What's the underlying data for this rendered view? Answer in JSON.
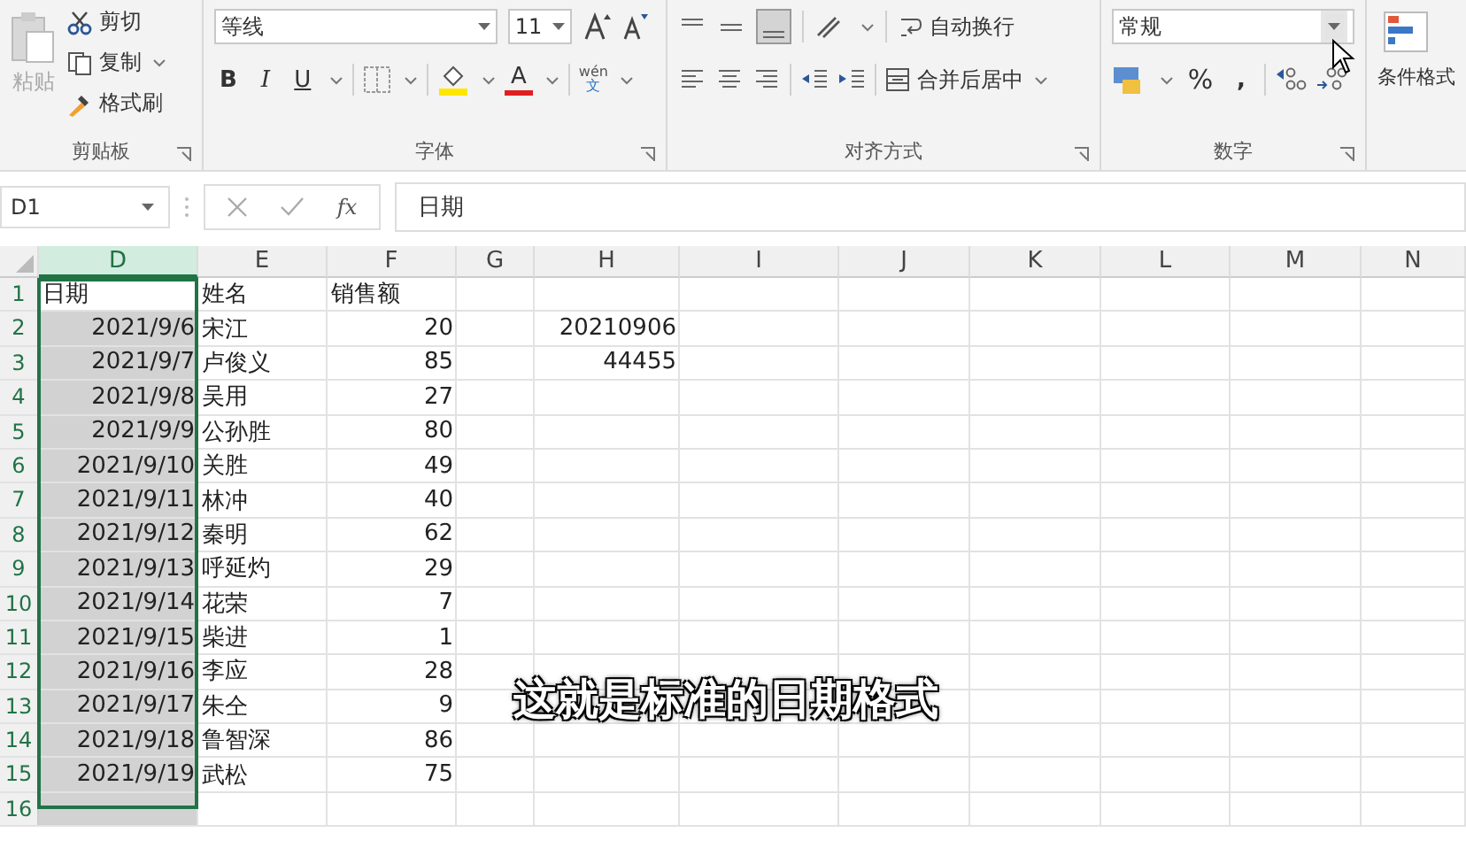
{
  "ribbon": {
    "clipboard": {
      "paste": "粘贴",
      "cut": "剪切",
      "copy": "复制",
      "format_painter": "格式刷",
      "label": "剪贴板"
    },
    "font": {
      "font_name": "等线",
      "font_size": "11",
      "bold": "B",
      "italic": "I",
      "underline": "U",
      "font_color": "A",
      "phonetic_top": "wén",
      "phonetic_bottom": "文",
      "label": "字体"
    },
    "alignment": {
      "wrap_text": "自动换行",
      "merge_center": "合并后居中",
      "label": "对齐方式"
    },
    "number": {
      "format": "常规",
      "percent": "%",
      "comma": ",",
      "label": "数字"
    },
    "styles": {
      "conditional_format": "条件格式"
    }
  },
  "formula_bar": {
    "name_box": "D1",
    "fx": "fx",
    "formula": "日期"
  },
  "columns": [
    {
      "label": "D",
      "selected": true
    },
    {
      "label": "E",
      "selected": false
    },
    {
      "label": "F",
      "selected": false
    },
    {
      "label": "G",
      "selected": false
    },
    {
      "label": "H",
      "selected": false
    },
    {
      "label": "I",
      "selected": false
    },
    {
      "label": "J",
      "selected": false
    },
    {
      "label": "K",
      "selected": false
    },
    {
      "label": "L",
      "selected": false
    },
    {
      "label": "M",
      "selected": false
    },
    {
      "label": "N",
      "selected": false
    }
  ],
  "rows": [
    {
      "number": "1",
      "kind": "header",
      "cells": [
        "日期",
        "姓名",
        "销售额"
      ]
    },
    {
      "number": "2",
      "kind": "data",
      "cells": [
        "2021/9/6",
        "宋江",
        "20",
        null,
        "20210906"
      ]
    },
    {
      "number": "3",
      "kind": "data",
      "cells": [
        "2021/9/7",
        "卢俊义",
        "85",
        null,
        "44455"
      ]
    },
    {
      "number": "4",
      "kind": "data",
      "cells": [
        "2021/9/8",
        "吴用",
        "27"
      ]
    },
    {
      "number": "5",
      "kind": "data",
      "cells": [
        "2021/9/9",
        "公孙胜",
        "80"
      ]
    },
    {
      "number": "6",
      "kind": "data",
      "cells": [
        "2021/9/10",
        "关胜",
        "49"
      ]
    },
    {
      "number": "7",
      "kind": "data",
      "cells": [
        "2021/9/11",
        "林冲",
        "40"
      ]
    },
    {
      "number": "8",
      "kind": "data",
      "cells": [
        "2021/9/12",
        "秦明",
        "62"
      ]
    },
    {
      "number": "9",
      "kind": "data",
      "cells": [
        "2021/9/13",
        "呼延灼",
        "29"
      ]
    },
    {
      "number": "10",
      "kind": "data",
      "cells": [
        "2021/9/14",
        "花荣",
        "7"
      ]
    },
    {
      "number": "11",
      "kind": "data",
      "cells": [
        "2021/9/15",
        "柴进",
        "1"
      ]
    },
    {
      "number": "12",
      "kind": "data",
      "cells": [
        "2021/9/16",
        "李应",
        "28"
      ]
    },
    {
      "number": "13",
      "kind": "data",
      "cells": [
        "2021/9/17",
        "朱仝",
        "9"
      ]
    },
    {
      "number": "14",
      "kind": "data",
      "cells": [
        "2021/9/18",
        "鲁智深",
        "86"
      ]
    },
    {
      "number": "15",
      "kind": "data",
      "cells": [
        "2021/9/19",
        "武松",
        "75"
      ]
    },
    {
      "number": "16",
      "kind": "data"
    }
  ],
  "subtitle": "这就是标准的日期格式"
}
